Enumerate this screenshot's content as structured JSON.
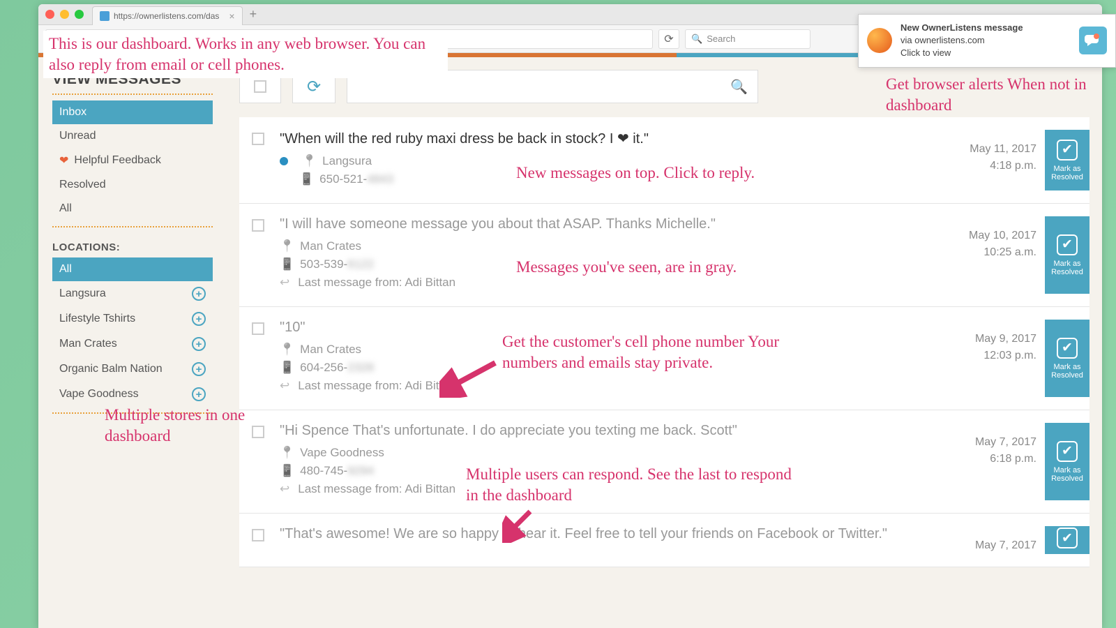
{
  "browser": {
    "tab_url": "https://ownerlistens.com/das",
    "search_placeholder": "Search"
  },
  "notification": {
    "title": "New OwnerListens message",
    "subtitle": "via ownerlistens.com",
    "action": "Click to view"
  },
  "sidebar": {
    "header": "VIEW MESSAGES",
    "items": [
      {
        "label": "Inbox",
        "active": true
      },
      {
        "label": "Unread"
      },
      {
        "label": "Helpful Feedback",
        "icon": "heart"
      },
      {
        "label": "Resolved"
      },
      {
        "label": "All"
      }
    ],
    "locations_label": "LOCATIONS:",
    "locations": [
      {
        "label": "All",
        "active": true
      },
      {
        "label": "Langsura"
      },
      {
        "label": "Lifestyle Tshirts"
      },
      {
        "label": "Man Crates"
      },
      {
        "label": "Organic Balm Nation"
      },
      {
        "label": "Vape Goodness"
      }
    ]
  },
  "resolve_label_1": "Mark as",
  "resolve_label_2": "Resolved",
  "messages": [
    {
      "quote": "\"When will the red ruby maxi dress be back in stock? I ❤ it.\"",
      "location": "Langsura",
      "phone_prefix": "650-521-",
      "phone_blur": "4843",
      "date": "May 11, 2017",
      "time": "4:18 p.m.",
      "unread": true
    },
    {
      "quote": "\"I will have someone message you about that ASAP. Thanks Michelle.\"",
      "location": "Man Crates",
      "phone_prefix": "503-539-",
      "phone_blur": "6122",
      "date": "May 10, 2017",
      "time": "10:25 a.m.",
      "last_from": "Last message from: Adi Bittan",
      "read": true
    },
    {
      "quote": "\"10\"",
      "location": "Man Crates",
      "phone_prefix": "604-256-",
      "phone_blur": "2328",
      "date": "May 9, 2017",
      "time": "12:03 p.m.",
      "last_from": "Last message from: Adi Bittan",
      "read": true
    },
    {
      "quote": "\"Hi Spence   That's unfortunate. I do appreciate you texting me back. Scott\"",
      "location": "Vape Goodness",
      "phone_prefix": "480-745-",
      "phone_blur": "9294",
      "date": "May 7, 2017",
      "time": "6:18 p.m.",
      "last_from": "Last message from: Adi Bittan",
      "read": true
    },
    {
      "quote": "\"That's awesome! We are so happy to hear it. Feel free to tell your friends on Facebook or Twitter.\"",
      "date": "May 7, 2017",
      "read": true
    }
  ],
  "annotations": {
    "a1": "This is our dashboard. Works in any web browser. You can also reply from email or cell phones.",
    "a2": "Get browser alerts When not in dashboard",
    "a3": "New messages on top. Click to reply.",
    "a4": "Messages you've seen, are in gray.",
    "a5": "Get the customer's cell phone number Your numbers and emails stay private.",
    "a6": "Multiple users can respond. See the last to respond in the dashboard",
    "a7": "Multiple stores in one dashboard"
  }
}
